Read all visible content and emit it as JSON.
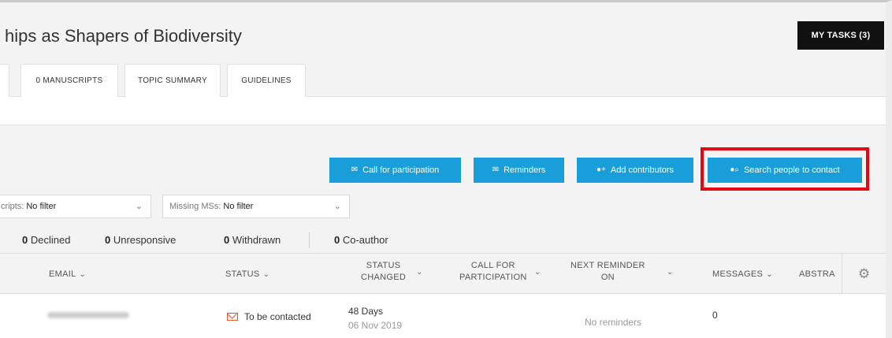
{
  "header": {
    "title": "hips as Shapers of Biodiversity",
    "my_tasks": "MY TASKS (3)"
  },
  "tabs": [
    {
      "label": ""
    },
    {
      "label": "0 MANUSCRIPTS"
    },
    {
      "label": "TOPIC SUMMARY"
    },
    {
      "label": "GUIDELINES"
    }
  ],
  "actions": {
    "call": {
      "label": "Call for participation",
      "icon": "envelope-icon"
    },
    "reminders": {
      "label": "Reminders",
      "icon": "envelope-icon"
    },
    "add": {
      "label": "Add contributors",
      "icon": "add-person-icon"
    },
    "search": {
      "label": "Search people to contact",
      "icon": "search-person-icon"
    },
    "accent_color": "#1a9ed9",
    "highlight_color": "#e30613"
  },
  "filters": [
    {
      "label": "cripts:",
      "value": "No filter"
    },
    {
      "label": "Missing MSs:",
      "value": "No filter"
    }
  ],
  "counts": [
    {
      "num": "0",
      "label": "Declined"
    },
    {
      "num": "0",
      "label": "Unresponsive"
    },
    {
      "num": "0",
      "label": "Withdrawn"
    },
    {
      "num": "0",
      "label": "Co-author"
    }
  ],
  "table": {
    "columns": {
      "email": "EMAIL",
      "status": "STATUS",
      "status_changed_1": "STATUS",
      "status_changed_2": "CHANGED",
      "call_1": "CALL FOR",
      "call_2": "PARTICIPATION",
      "next_1": "NEXT REMINDER",
      "next_2": "ON",
      "messages": "MESSAGES",
      "abstract": "ABSTRA"
    },
    "rows": [
      {
        "status": "To be contacted",
        "status_changed_days": "48 Days",
        "status_changed_date": "06 Nov 2019",
        "next_reminder": "No reminders",
        "messages": "0"
      }
    ]
  }
}
